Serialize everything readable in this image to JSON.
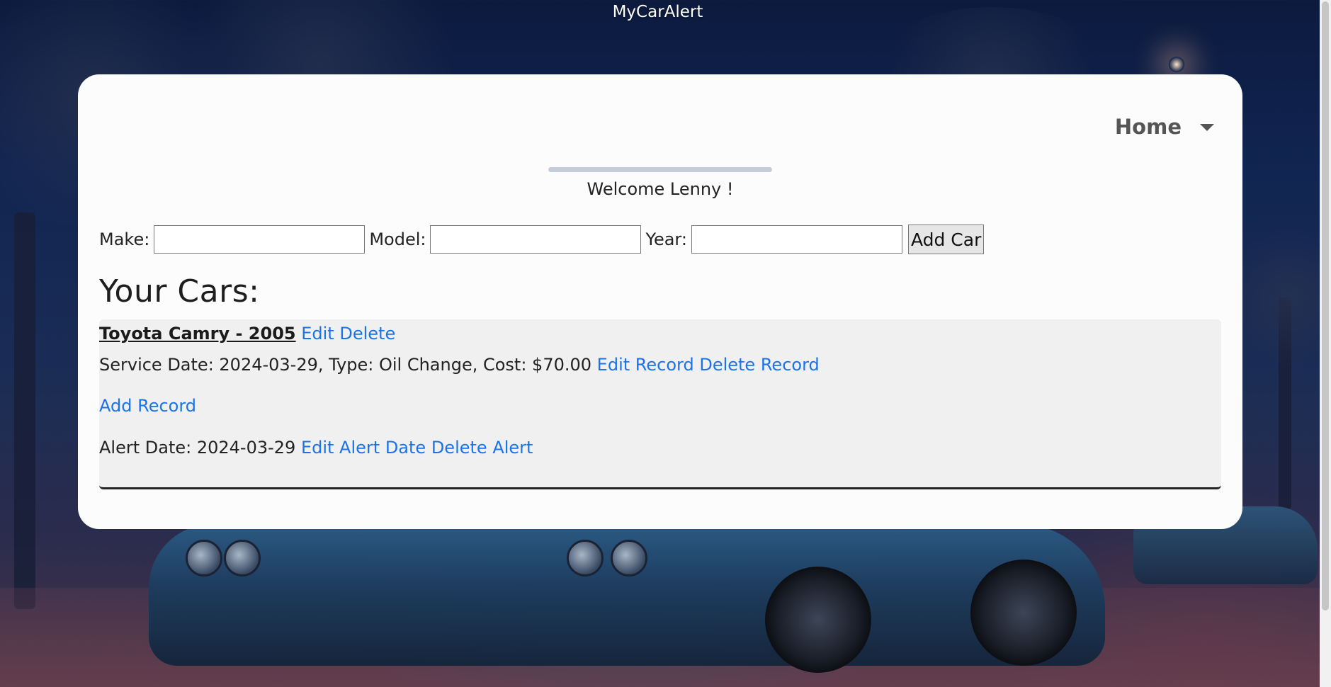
{
  "app": {
    "title": "MyCarAlert"
  },
  "nav": {
    "label": "Home"
  },
  "welcome": {
    "text": "Welcome Lenny !"
  },
  "add_car_form": {
    "make_label": "Make:",
    "model_label": "Model:",
    "year_label": "Year:",
    "make_value": "",
    "model_value": "",
    "year_value": "",
    "submit_label": "Add Car"
  },
  "cars_section": {
    "title": "Your Cars:"
  },
  "cars": [
    {
      "name": "Toyota Camry - 2005",
      "edit_label": "Edit",
      "delete_label": "Delete",
      "records": [
        {
          "text": "Service Date: 2024-03-29, Type: Oil Change, Cost: $70.00",
          "edit_label": "Edit Record",
          "delete_label": "Delete Record"
        }
      ],
      "add_record_label": "Add Record",
      "alert": {
        "text": "Alert Date: 2024-03-29",
        "edit_label": "Edit Alert Date",
        "delete_label": "Delete Alert"
      }
    }
  ],
  "colors": {
    "link": "#1a73e8",
    "card_background": "#fcfcfc",
    "panel_background": "#f0f0f0",
    "page_background": "#112552"
  }
}
